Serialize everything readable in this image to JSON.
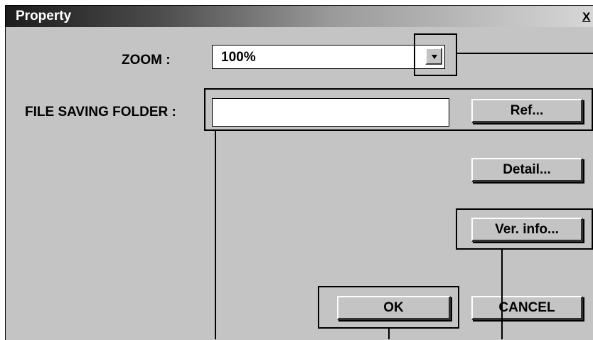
{
  "window": {
    "title": "Property",
    "close_label": "X"
  },
  "zoom": {
    "label": "ZOOM :",
    "value": "100%"
  },
  "folder": {
    "label": "FILE SAVING FOLDER :",
    "value": ""
  },
  "buttons": {
    "ref": "Ref...",
    "detail": "Detail...",
    "ver_info": "Ver. info...",
    "ok": "OK",
    "cancel": "CANCEL"
  }
}
